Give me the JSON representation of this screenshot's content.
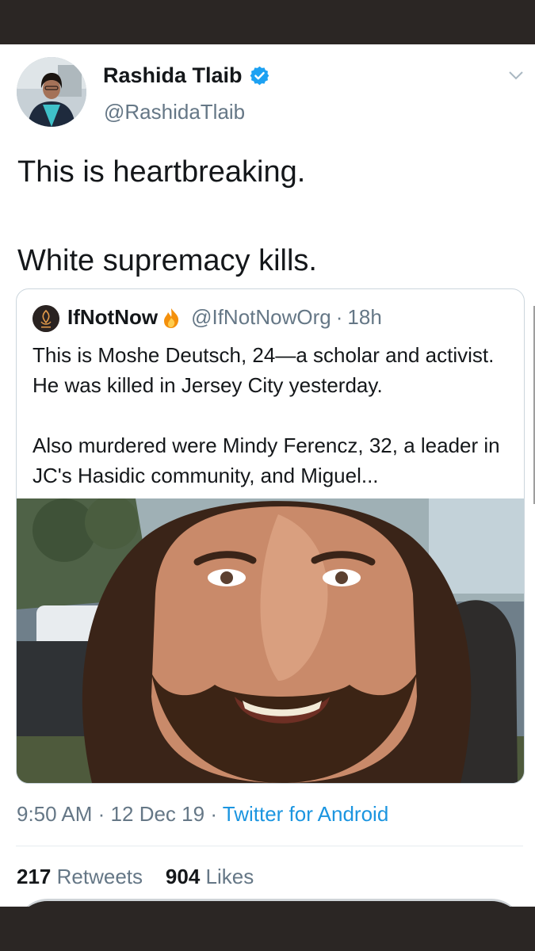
{
  "tweet": {
    "author_name": "Rashida Tlaib",
    "handle": "@RashidaTlaib",
    "text": "This is heartbreaking.\n\nWhite supremacy kills.",
    "verified_icon": "verified-badge-icon",
    "menu_icon": "chevron-down-icon"
  },
  "quoted_tweet": {
    "author_name": "IfNotNow",
    "handle": "@IfNotNowOrg",
    "separator": "·",
    "time": "18h",
    "text": "This is Moshe Deutsch, 24—a scholar and activist. He was killed in Jersey City yesterday.\n\nAlso murdered were Mindy Ferencz, 32, a leader in JC's Hasidic community, and Miguel..."
  },
  "meta": {
    "time": "9:50 AM",
    "date": "12 Dec 19",
    "separator": "·",
    "source": "Twitter for Android"
  },
  "stats": {
    "retweets_count": "217",
    "retweets_label": "Retweets",
    "likes_count": "904",
    "likes_label": "Likes"
  },
  "colors": {
    "link": "#1b95e0",
    "verified": "#1da1f2",
    "secondary_text": "#657786",
    "frame": "#2b2624"
  }
}
